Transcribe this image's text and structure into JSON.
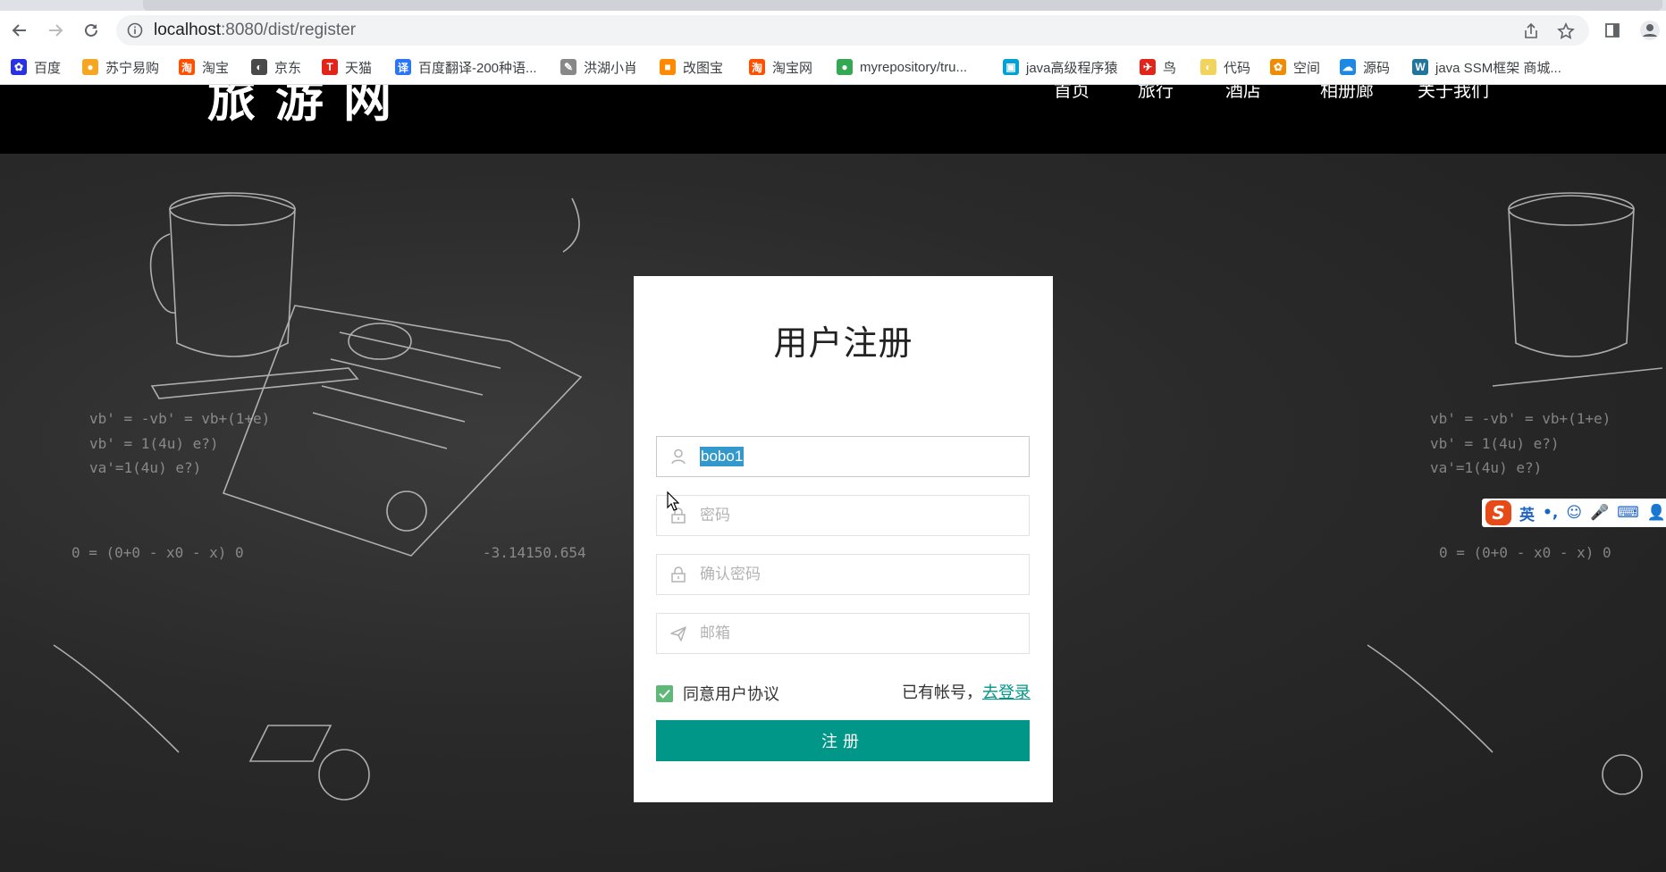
{
  "browser": {
    "url_host": "localhost",
    "url_path": ":8080/dist/register",
    "bookmarks": [
      {
        "label": "百度",
        "color": "#2932e1",
        "glyph": "✿"
      },
      {
        "label": "苏宁易购",
        "color": "#f5a623",
        "glyph": "●"
      },
      {
        "label": "淘宝",
        "color": "#ff5000",
        "glyph": "淘"
      },
      {
        "label": "京东",
        "color": "#4a4a4a",
        "glyph": "◐"
      },
      {
        "label": "天猫",
        "color": "#e1251b",
        "glyph": "T"
      },
      {
        "label": "百度翻译-200种语...",
        "color": "#2b76f6",
        "glyph": "译"
      },
      {
        "label": "洪湖小肖",
        "color": "#888888",
        "glyph": "✎"
      },
      {
        "label": "改图宝",
        "color": "#ff8a00",
        "glyph": "■"
      },
      {
        "label": "淘宝网",
        "color": "#ff5000",
        "glyph": "淘"
      },
      {
        "label": "myrepository/tru...",
        "color": "#34a853",
        "glyph": "●"
      },
      {
        "label": "java高级程序猿",
        "color": "#00a1d6",
        "glyph": "▣"
      },
      {
        "label": "鸟",
        "color": "#e1251b",
        "glyph": "✈"
      },
      {
        "label": "代码",
        "color": "#f2d35b",
        "glyph": "◐"
      },
      {
        "label": "空间",
        "color": "#f08c00",
        "glyph": "✿"
      },
      {
        "label": "源码",
        "color": "#1e88e5",
        "glyph": "☁"
      },
      {
        "label": "java SSM框架 商城...",
        "color": "#21759b",
        "glyph": "W"
      }
    ]
  },
  "site": {
    "logo": "旅游网",
    "nav": [
      "首页",
      "旅行",
      "酒店",
      "相册廊",
      "关于我们"
    ]
  },
  "register": {
    "title": "用户注册",
    "username_value": "bobo1",
    "password_placeholder": "密码",
    "confirm_placeholder": "确认密码",
    "email_placeholder": "邮箱",
    "agree_label": "同意用户协议",
    "agree_checked": true,
    "has_account_text": "已有帐号，",
    "login_link": "去登录",
    "submit_label": "注册"
  },
  "ime": {
    "mode": "英",
    "items": [
      "•,",
      "☺",
      "🎤",
      "⌨",
      "👤"
    ]
  },
  "colors": {
    "accent": "#009688",
    "checkbox": "#5fb878",
    "header_bg": "#000000",
    "selection": "#3399cc"
  }
}
